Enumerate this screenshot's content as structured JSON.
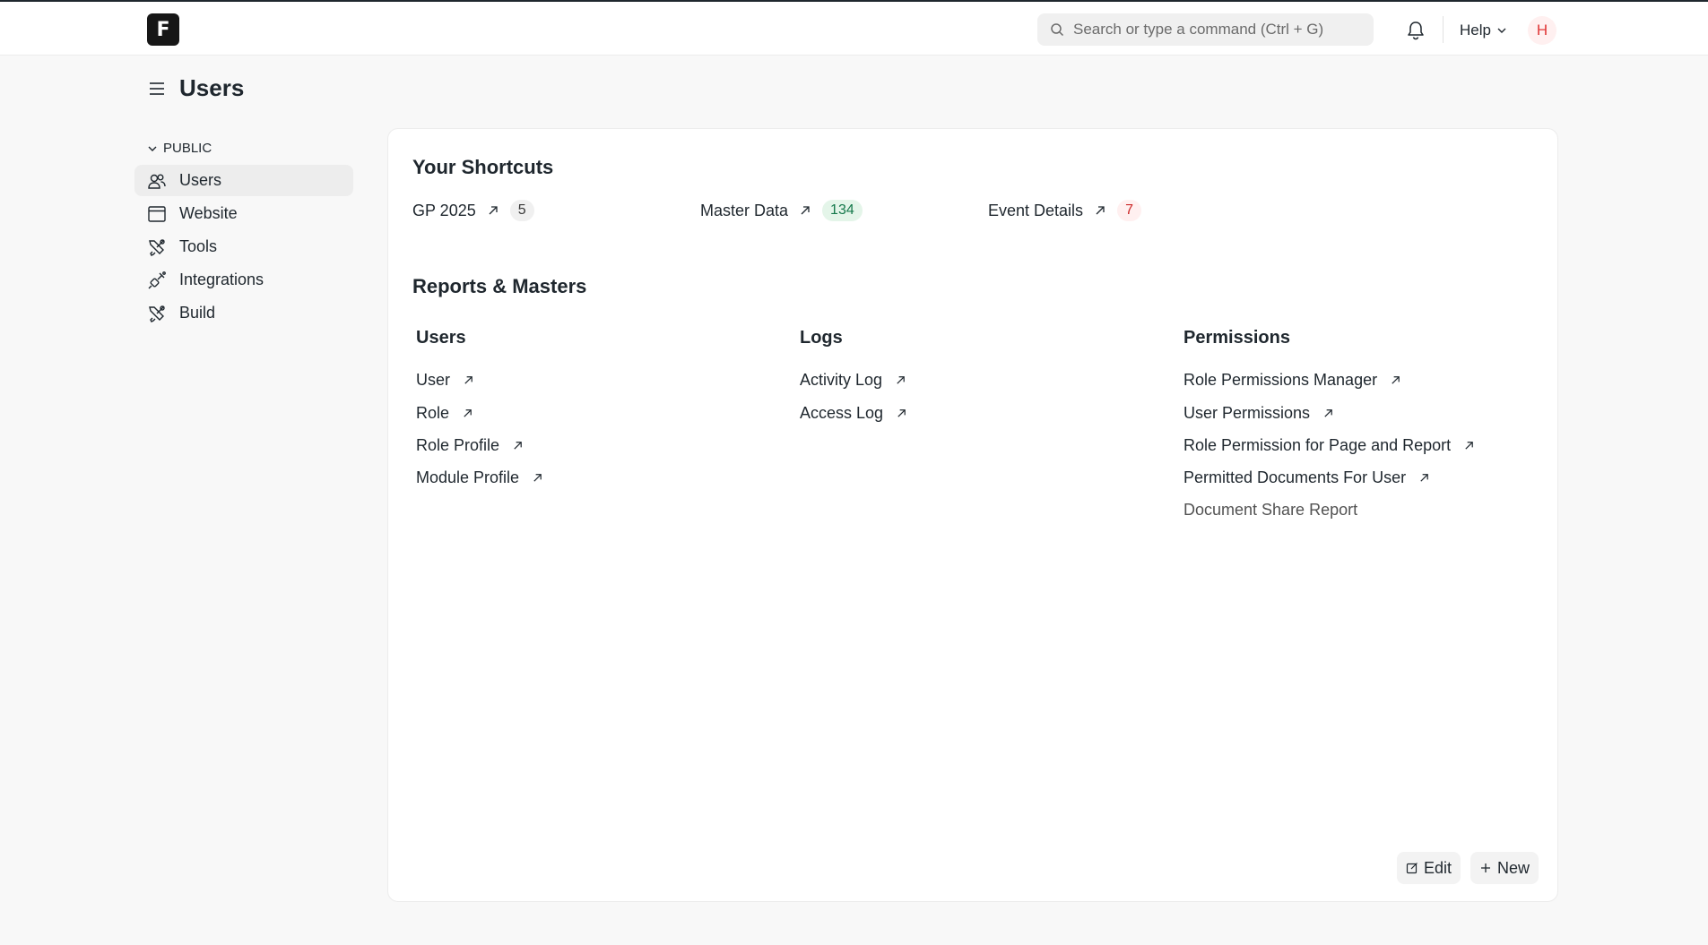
{
  "header": {
    "logo_letter": "F",
    "search_placeholder": "Search or type a command (Ctrl + G)",
    "help_label": "Help",
    "avatar_initial": "H"
  },
  "page": {
    "title": "Users"
  },
  "sidebar": {
    "section_label": "PUBLIC",
    "items": [
      {
        "label": "Users",
        "icon": "users-icon",
        "active": true
      },
      {
        "label": "Website",
        "icon": "website-icon",
        "active": false
      },
      {
        "label": "Tools",
        "icon": "tools-icon",
        "active": false
      },
      {
        "label": "Integrations",
        "icon": "integrations-icon",
        "active": false
      },
      {
        "label": "Build",
        "icon": "build-icon",
        "active": false
      }
    ]
  },
  "shortcuts": {
    "title": "Your Shortcuts",
    "items": [
      {
        "label": "GP 2025",
        "count": "5",
        "badge_color": "gray"
      },
      {
        "label": "Master Data",
        "count": "134",
        "badge_color": "green"
      },
      {
        "label": "Event Details",
        "count": "7",
        "badge_color": "red"
      }
    ]
  },
  "reports": {
    "title": "Reports & Masters",
    "columns": [
      {
        "title": "Users",
        "links": [
          "User",
          "Role",
          "Role Profile",
          "Module Profile"
        ]
      },
      {
        "title": "Logs",
        "links": [
          "Activity Log",
          "Access Log"
        ]
      },
      {
        "title": "Permissions",
        "links": [
          "Role Permissions Manager",
          "User Permissions",
          "Role Permission for Page and Report",
          "Permitted Documents For User",
          "Document Share Report"
        ]
      }
    ]
  },
  "actions": {
    "edit_label": "Edit",
    "new_label": "New"
  },
  "colors": {
    "badge_green_bg": "#e4f5e9",
    "badge_red_bg": "#fff0f0",
    "avatar_fg": "#e03636",
    "logo_bg": "#171717"
  }
}
